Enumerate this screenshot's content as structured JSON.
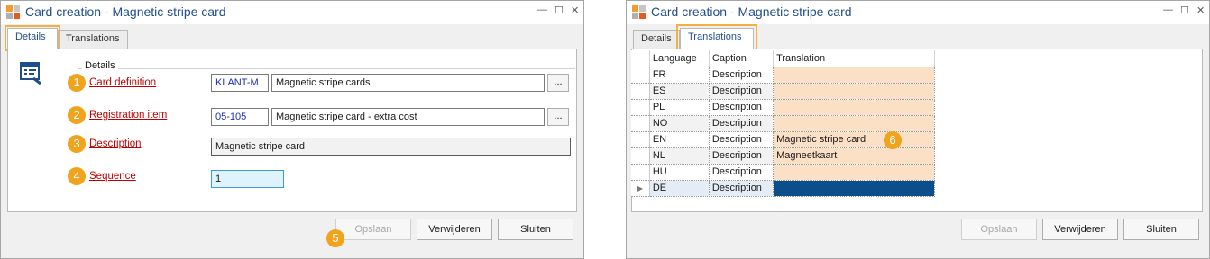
{
  "window1": {
    "title": "Card creation - Magnetic stripe card",
    "controls": {
      "minimize": "—",
      "maximize": "☐",
      "close": "✕"
    },
    "tabs": [
      {
        "label": "Details",
        "active": true
      },
      {
        "label": "Translations",
        "active": false
      }
    ],
    "group_label": "Details",
    "fields": {
      "card_definition": {
        "label": "Card definition",
        "code": "KLANT-M",
        "value": "Magnetic stripe cards"
      },
      "registration_item": {
        "label": "Registration item",
        "code": "05-105",
        "value": "Magnetic stripe card - extra cost"
      },
      "description": {
        "label": "Description",
        "value": "Magnetic stripe card"
      },
      "sequence": {
        "label": "Sequence",
        "value": "1"
      }
    },
    "ellipsis": "...",
    "buttons": {
      "save": "Opslaan",
      "delete": "Verwijderen",
      "close": "Sluiten"
    },
    "badges": [
      "1",
      "2",
      "3",
      "4",
      "5"
    ]
  },
  "window2": {
    "title": "Card creation - Magnetic stripe card",
    "controls": {
      "minimize": "—",
      "maximize": "☐",
      "close": "✕"
    },
    "tabs": [
      {
        "label": "Details",
        "active": false
      },
      {
        "label": "Translations",
        "active": true
      }
    ],
    "columns": [
      "Language",
      "Caption",
      "Translation"
    ],
    "rows": [
      {
        "language": "FR",
        "caption": "Description",
        "translation": ""
      },
      {
        "language": "ES",
        "caption": "Description",
        "translation": ""
      },
      {
        "language": "PL",
        "caption": "Description",
        "translation": ""
      },
      {
        "language": "NO",
        "caption": "Description",
        "translation": ""
      },
      {
        "language": "EN",
        "caption": "Description",
        "translation": "Magnetic stripe card"
      },
      {
        "language": "NL",
        "caption": "Description",
        "translation": "Magneetkaart"
      },
      {
        "language": "HU",
        "caption": "Description",
        "translation": ""
      },
      {
        "language": "DE",
        "caption": "Description",
        "translation": "",
        "current": true
      }
    ],
    "current_row_marker": "▶",
    "buttons": {
      "save": "Opslaan",
      "delete": "Verwijderen",
      "close": "Sluiten"
    },
    "badge": "6"
  },
  "colors": {
    "accent": "#f5b041",
    "badge": "#f0a31d",
    "link": "#c00000",
    "title": "#1f4e8c",
    "translation_cell": "#fbe0c6",
    "selected_cell": "#0a4f8c"
  }
}
